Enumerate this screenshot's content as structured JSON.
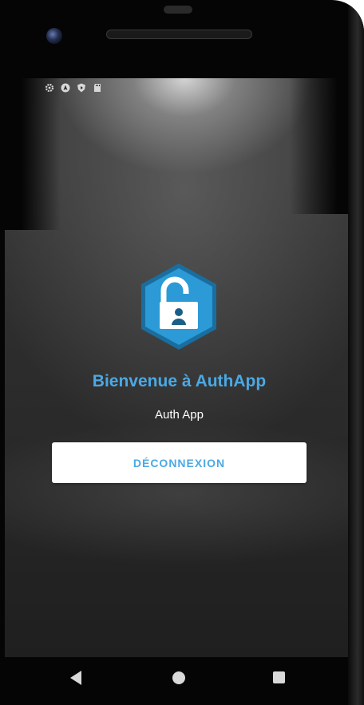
{
  "app": {
    "title": "Bienvenue à AuthApp",
    "subtitle": "Auth App",
    "logout_label": "DÉCONNEXION"
  },
  "status_bar": {
    "icons": [
      "gear-icon",
      "navigation-icon",
      "shield-play-icon",
      "sd-card-icon"
    ]
  },
  "logo": {
    "icon": "unlocked-padlock-user-icon",
    "hex_color": "#2b9ad6",
    "hex_border_color": "#1a6e9f"
  },
  "nav_bar": {
    "buttons": [
      "back-icon",
      "home-icon",
      "recent-apps-icon"
    ]
  },
  "colors": {
    "accent": "#4ba9e4",
    "button_bg": "#ffffff",
    "background": "#2a2a2a"
  }
}
